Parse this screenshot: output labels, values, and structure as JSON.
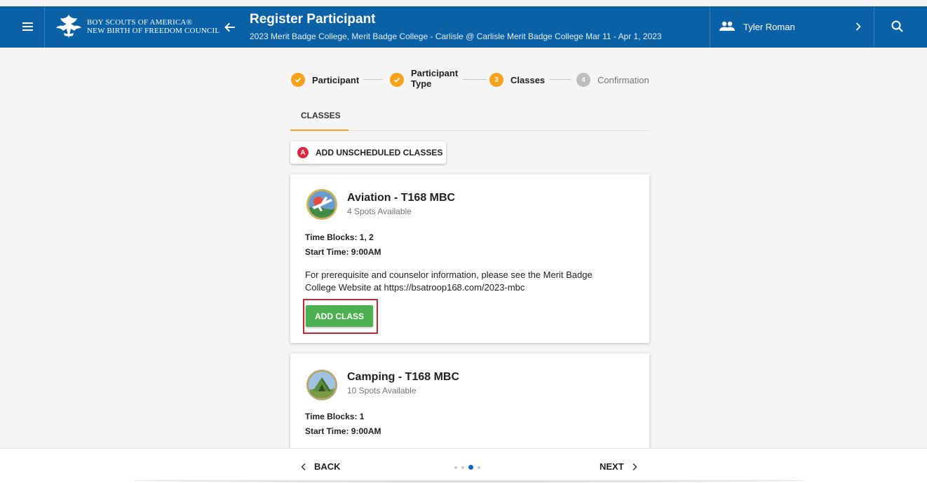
{
  "header": {
    "org_line1": "BOY SCOUTS OF AMERICA®",
    "org_line2": "NEW BIRTH OF FREEDOM COUNCIL",
    "title": "Register Participant",
    "subtitle": "2023 Merit Badge College, Merit Badge College - Carlisle @ Carlisle Merit Badge College Mar 11 - Apr 1, 2023",
    "user_name": "Tyler Roman",
    "icons": {
      "menu": "hamburger-menu-icon",
      "back": "arrow-left-icon",
      "user": "people-icon",
      "chevron": "chevron-right-icon",
      "search": "search-icon"
    }
  },
  "stepper": {
    "steps": [
      {
        "label": "Participant",
        "state": "complete"
      },
      {
        "label": "Participant Type",
        "label_line1": "Participant",
        "label_line2": "Type",
        "state": "complete"
      },
      {
        "label": "Classes",
        "number": "3",
        "state": "active"
      },
      {
        "label": "Confirmation",
        "number": "4",
        "state": "inactive"
      }
    ]
  },
  "tabs": {
    "active_tab": "CLASSES"
  },
  "unscheduled": {
    "badge": "A",
    "label": "ADD UNSCHEDULED CLASSES"
  },
  "classes": [
    {
      "title": "Aviation - T168 MBC",
      "spots": "4 Spots Available",
      "time_blocks": "Time Blocks: 1, 2",
      "start_time": "Start Time: 9:00AM",
      "description_line1": "For prerequisite and counselor information, please see the Merit Badge",
      "description_line2": "College Website at https://bsatroop168.com/2023-mbc",
      "button_label": "ADD CLASS",
      "badge_icon": "aviation-merit-badge-icon"
    },
    {
      "title": "Camping - T168 MBC",
      "spots": "10 Spots Available",
      "time_blocks": "Time Blocks: 1",
      "start_time": "Start Time: 9:00AM",
      "badge_icon": "camping-merit-badge-icon"
    }
  ],
  "footer_nav": {
    "back_label": "BACK",
    "next_label": "NEXT",
    "page_dots": 4,
    "active_dot": 3
  },
  "colors": {
    "header_bg": "#0a61a6",
    "step_complete": "#f6a11a",
    "step_active": "#f6a11a",
    "step_inactive": "#bdbdbd",
    "tab_underline": "#f6a11a",
    "add_button": "#4caf50",
    "unscheduled_badge": "#e0263c",
    "highlight": "#d0232f",
    "active_dot": "#1565c0"
  }
}
